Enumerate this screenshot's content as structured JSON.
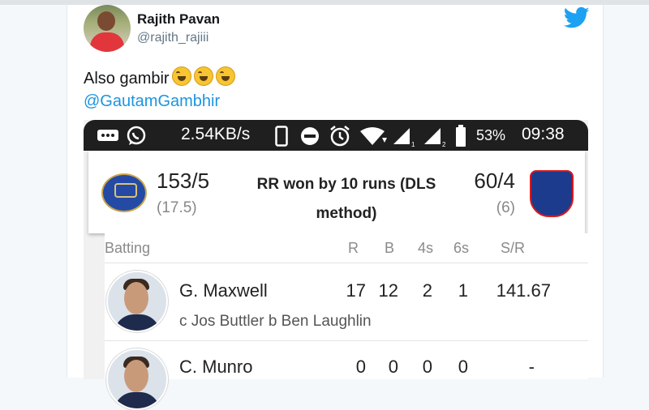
{
  "tweet": {
    "author_name": "Rajith Pavan",
    "author_handle": "@rajith_rajiii",
    "text": "Also gambir",
    "mention": "@GautamGambhir",
    "emoji_count": 3
  },
  "status_bar": {
    "speed": "2.54KB/s",
    "battery": "53%",
    "time": "09:38",
    "icons": [
      "message-icon",
      "whatsapp-icon",
      "phone-icon",
      "dnd-icon",
      "alarm-icon",
      "wifi-icon",
      "signal-icon-1",
      "signal-icon-2",
      "battery-icon"
    ]
  },
  "match": {
    "team1_score": "153/5",
    "team1_overs": "(17.5)",
    "result_line1": "RR won by 10 runs (DLS",
    "result_line2": "method)",
    "team2_score": "60/4",
    "team2_overs": "(6)",
    "team1_logo": "rajasthan-royals-logo",
    "team2_logo": "delhi-capitals-logo"
  },
  "batting": {
    "headers": {
      "label": "Batting",
      "r": "R",
      "b": "B",
      "fours": "4s",
      "sixes": "6s",
      "sr": "S/R"
    },
    "players": [
      {
        "name": "G. Maxwell",
        "r": "17",
        "b": "12",
        "fours": "2",
        "sixes": "1",
        "sr": "141.67",
        "dismissal": "c Jos Buttler b Ben Laughlin"
      },
      {
        "name": "C. Munro",
        "r": "0",
        "b": "0",
        "fours": "0",
        "sixes": "0",
        "sr": "-"
      }
    ]
  },
  "colors": {
    "twitter_blue": "#1da1f2",
    "link": "#1b95e0",
    "status_bar": "#1f1f1f"
  }
}
